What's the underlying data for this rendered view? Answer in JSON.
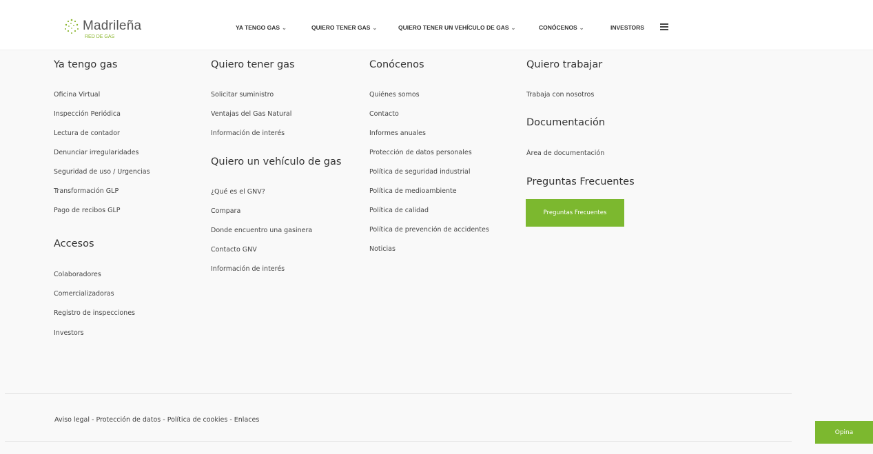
{
  "header": {
    "logo_name": "Madrileña",
    "logo_sub": "RED DE GAS",
    "nav": [
      {
        "label": "YA TENGO GAS",
        "chevron": "⌄"
      },
      {
        "label": "QUIERO TENER GAS",
        "chevron": "⌄"
      },
      {
        "label": "QUIERO TENER UN VEHÍCULO DE GAS",
        "chevron": "⌄"
      },
      {
        "label": "CONÓCENOS",
        "chevron": "⌄"
      },
      {
        "label": "INVESTORS"
      }
    ],
    "menu_icon": "hamburger-icon"
  },
  "menu": {
    "ya_tengo_gas": {
      "title": "Ya tengo gas",
      "links": [
        "Oficina Virtual",
        "Inspección Periódica",
        "Lectura de contador",
        "Denunciar irregularidades",
        "Seguridad de uso / Urgencias",
        "Transformación GLP",
        "Pago de recibos GLP"
      ]
    },
    "accesos": {
      "title": "Accesos",
      "links": [
        "Colaboradores",
        "Comercializadoras",
        "Registro de inspecciones",
        "Investors"
      ]
    },
    "quiero_tener_gas": {
      "title": "Quiero tener gas",
      "links": [
        "Solicitar suministro",
        "Ventajas del Gas Natural",
        "Información de interés"
      ]
    },
    "vehiculo": {
      "title": "Quiero un vehículo de gas",
      "links": [
        "¿Qué es el GNV?",
        "Compara",
        "Donde encuentro una gasinera",
        "Contacto GNV",
        "Información de interés"
      ]
    },
    "conocenos": {
      "title": "Conócenos",
      "links": [
        "Quiénes somos",
        "Contacto",
        "Informes anuales",
        "Protección de datos personales",
        "Política de seguridad industrial",
        "Política de medioambiente",
        "Política de calidad",
        "Política de prevención de accidentes",
        "Noticias"
      ]
    },
    "quiero_trabajar": {
      "title": "Quiero trabajar",
      "links": [
        "Trabaja con nosotros"
      ]
    },
    "documentacion": {
      "title": "Documentación",
      "links": [
        "Área de documentación"
      ]
    },
    "faq": {
      "title": "Preguntas Frecuentes",
      "button": "Preguntas Frecuentes"
    }
  },
  "footer": {
    "links": [
      "Aviso legal",
      "Protección de datos",
      "Política de cookies",
      "Enlaces"
    ],
    "separator": " - "
  },
  "feedback_button": "Opina",
  "colors": {
    "accent": "#7cb82f",
    "background": "#f9f9f9",
    "header_bg": "#ffffff",
    "text": "#333333"
  }
}
